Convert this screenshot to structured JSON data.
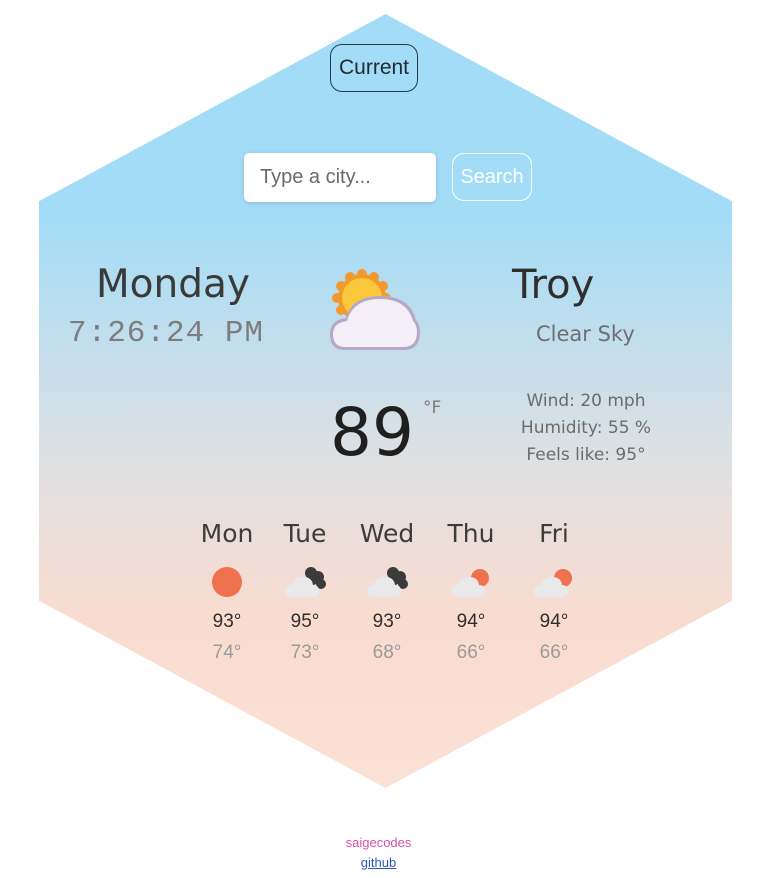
{
  "header": {
    "current_label": "Current"
  },
  "search": {
    "placeholder": "Type a city...",
    "button_label": "Search"
  },
  "current": {
    "day": "Monday",
    "time": "7:26:24 PM",
    "city": "Troy",
    "condition": "Clear Sky",
    "icon": "partly-cloudy-icon",
    "temperature": "89",
    "unit": "°F",
    "wind": "Wind: 20 mph",
    "humidity": "Humidity: 55 %",
    "feels_like": "Feels like: 95°"
  },
  "forecast": [
    {
      "day": "Mon",
      "icon": "sun-icon",
      "high": "93°",
      "low": "74°"
    },
    {
      "day": "Tue",
      "icon": "dark-clouds-icon",
      "high": "95°",
      "low": "73°"
    },
    {
      "day": "Wed",
      "icon": "dark-clouds-icon",
      "high": "93°",
      "low": "68°"
    },
    {
      "day": "Thu",
      "icon": "sun-behind-cloud-icon",
      "high": "94°",
      "low": "66°"
    },
    {
      "day": "Fri",
      "icon": "sun-behind-cloud-icon",
      "high": "94°",
      "low": "66°"
    }
  ],
  "footer": {
    "author": "saigecodes",
    "link": "github"
  },
  "colors": {
    "sky": "#a3dcf7",
    "peach": "#fbe1d5",
    "sun": "#f0714d",
    "author": "#d94fb5",
    "link": "#2a55c7"
  }
}
